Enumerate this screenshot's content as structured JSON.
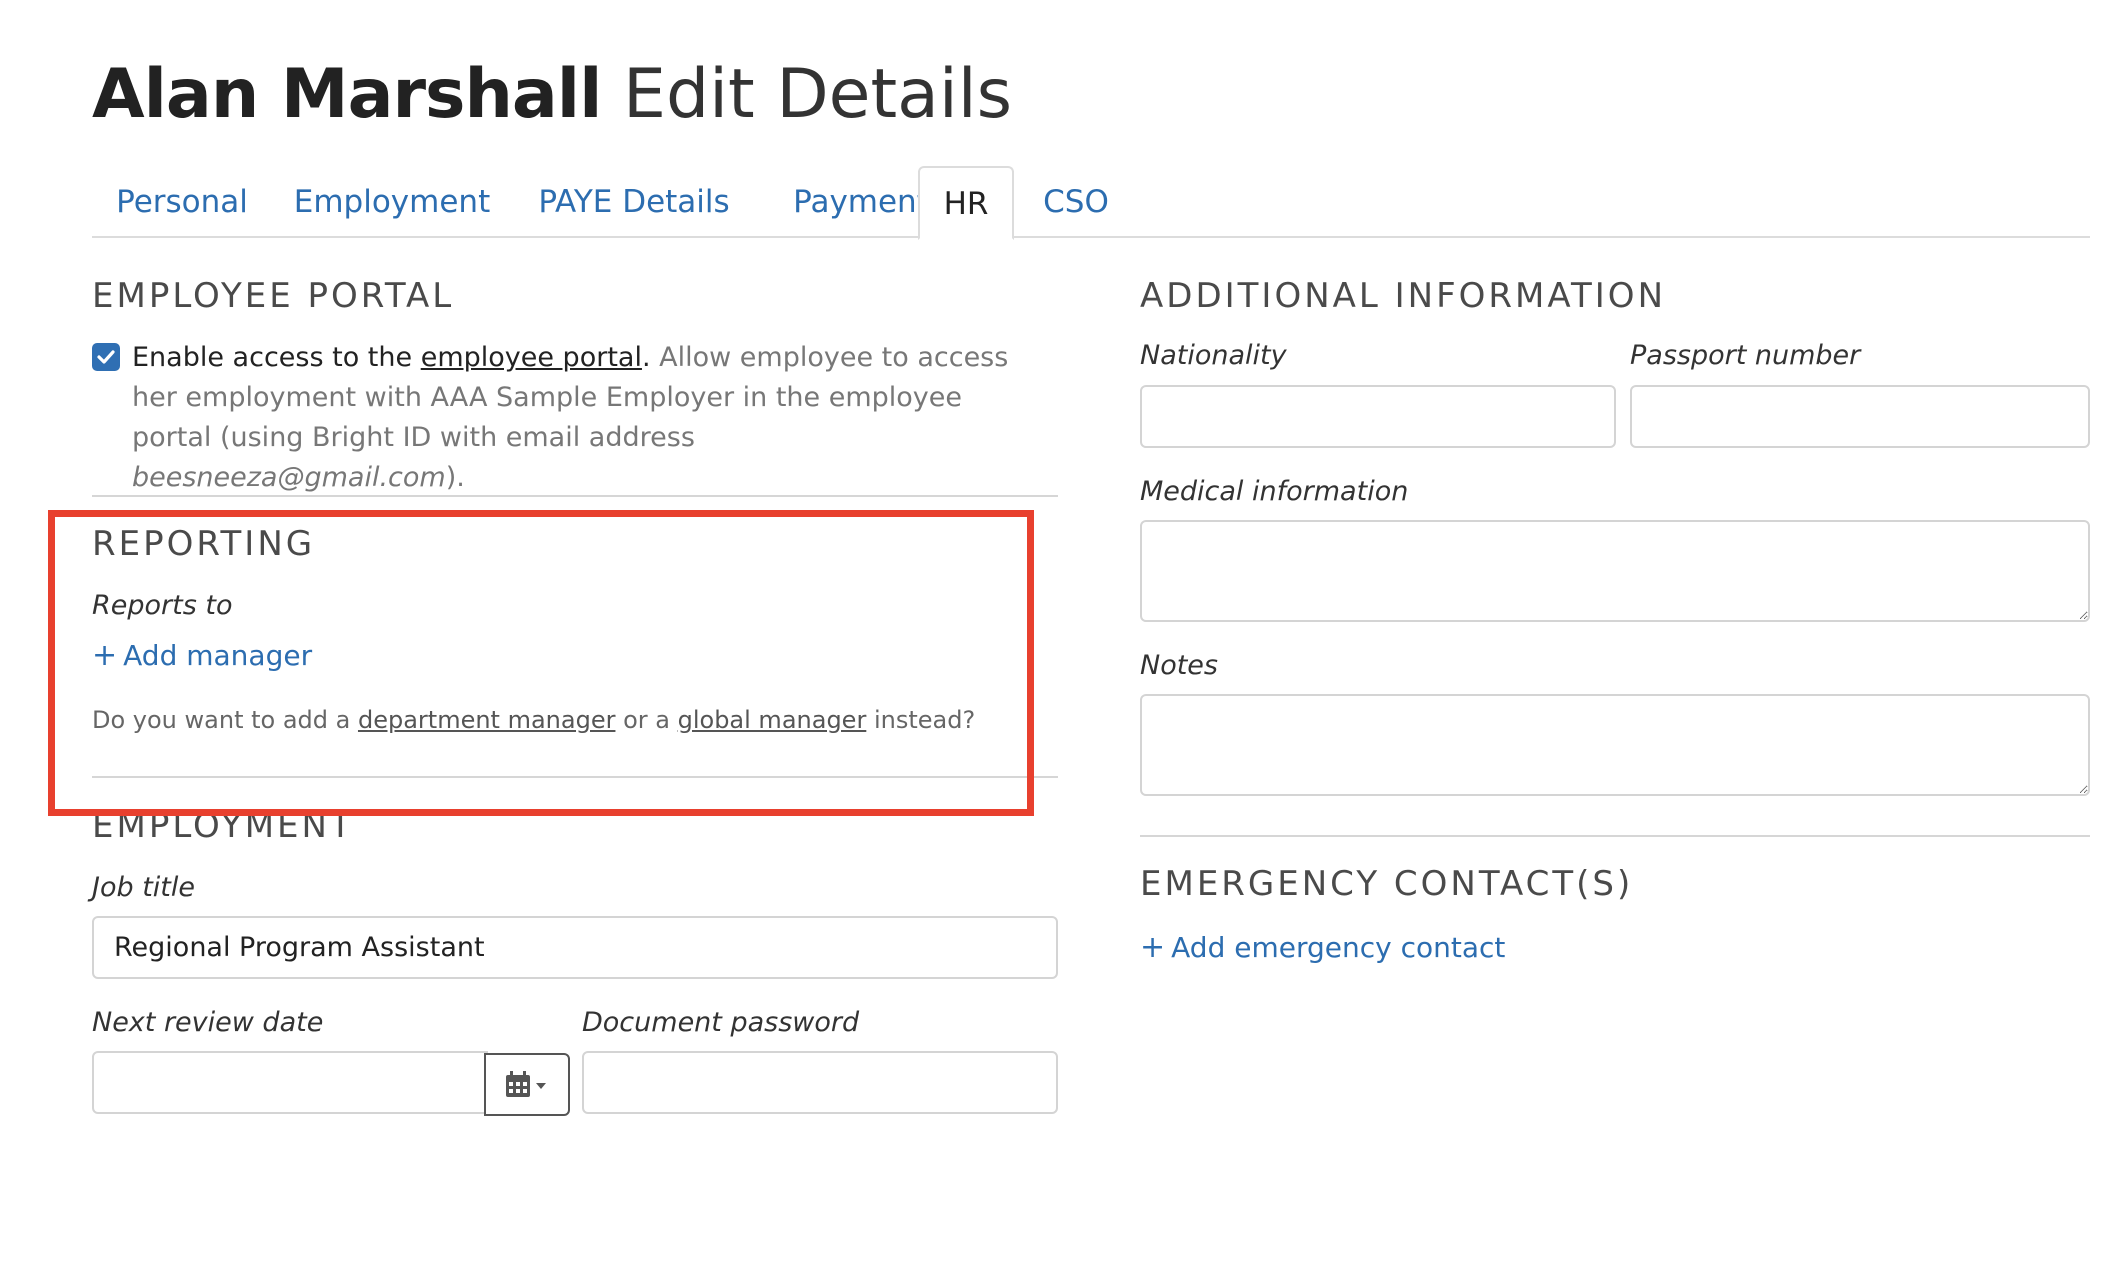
{
  "page": {
    "employee_name": "Alan Marshall",
    "title_suffix": "Edit Details"
  },
  "tabs": [
    {
      "label": "Personal",
      "active": false
    },
    {
      "label": "Employment",
      "active": false
    },
    {
      "label": "PAYE Details",
      "active": false
    },
    {
      "label": "Payment",
      "active": false
    },
    {
      "label": "HR",
      "active": true
    },
    {
      "label": "CSO",
      "active": false
    }
  ],
  "employee_portal": {
    "heading": "EMPLOYEE PORTAL",
    "checked": true,
    "lead_text": "Enable access to the ",
    "link_text": "employee portal",
    "after_link": ".",
    "description": " Allow employee to access her employment with AAA Sample Employer in the employee portal (using Bright ID with email address ",
    "email": "beesneeza@gmail.com",
    "closing": ")."
  },
  "reporting": {
    "heading": "REPORTING",
    "reports_to_label": "Reports to",
    "add_manager_label": "Add manager",
    "hint_prefix": "Do you want to add a ",
    "department_manager_link": "department manager",
    "hint_middle": " or a ",
    "global_manager_link": "global manager",
    "hint_suffix": " instead?"
  },
  "employment": {
    "heading": "EMPLOYMENT",
    "job_title_label": "Job title",
    "job_title_value": "Regional Program Assistant",
    "next_review_label": "Next review date",
    "next_review_value": "",
    "document_password_label": "Document password",
    "document_password_value": ""
  },
  "additional_information": {
    "heading": "ADDITIONAL INFORMATION",
    "nationality_label": "Nationality",
    "nationality_value": "",
    "passport_label": "Passport number",
    "passport_value": "",
    "medical_label": "Medical information",
    "medical_value": "",
    "notes_label": "Notes",
    "notes_value": ""
  },
  "emergency_contacts": {
    "heading": "EMERGENCY CONTACT(S)",
    "add_label": "Add emergency contact"
  },
  "colors": {
    "link": "#2c6db0",
    "highlight": "#e8402e",
    "checkbox": "#2f6fb3"
  },
  "icons": {
    "calendar": "calendar-icon",
    "caret": "caret-down-icon",
    "plus": "plus-icon",
    "check": "check-icon"
  }
}
